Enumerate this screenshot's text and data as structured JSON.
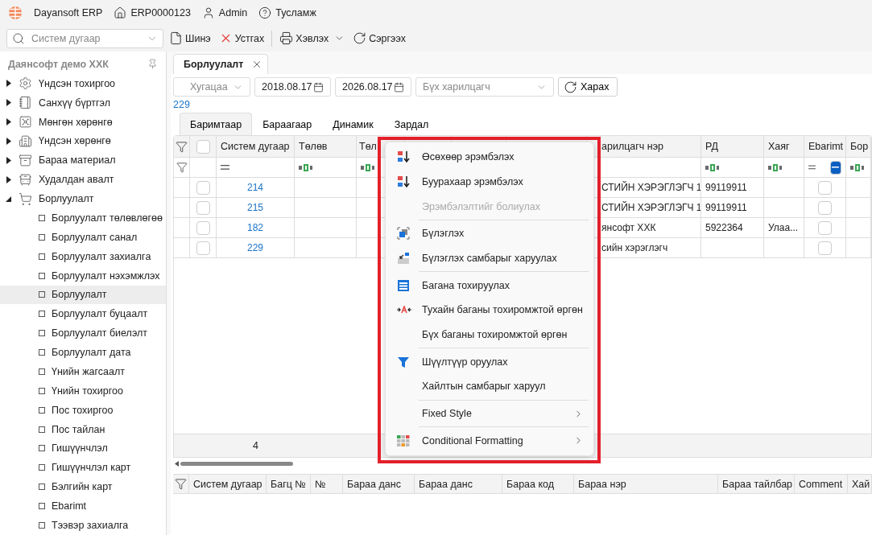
{
  "app_bar": {
    "app_name": "Dayansoft ERP",
    "database": "ERP0000123",
    "user": "Admin",
    "help": "Тусламж"
  },
  "toolbar": {
    "search_placeholder": "Систем дугаар",
    "buttons": [
      {
        "label": "Шинэ",
        "kind": "new"
      },
      {
        "label": "Устгах",
        "kind": "delete"
      },
      {
        "label": "Хэвлэх",
        "kind": "print"
      },
      {
        "label": "Сэргээх",
        "kind": "refresh"
      }
    ]
  },
  "sidebar": {
    "company": "Даянсофт демо ХХК",
    "items": [
      {
        "label": "Үндсэн тохиргоо",
        "expanded": false
      },
      {
        "label": "Санхүү бүртгэл",
        "expanded": false
      },
      {
        "label": "Мөнгөн хөрөнгө",
        "expanded": false
      },
      {
        "label": "Үндсэн хөрөнгө",
        "expanded": false
      },
      {
        "label": "Бараа материал",
        "expanded": false
      },
      {
        "label": "Худалдан авалт",
        "expanded": false
      },
      {
        "label": "Борлуулалт",
        "expanded": true,
        "children": [
          {
            "label": "Борлуулалт төлөвлөгөө",
            "selected": false
          },
          {
            "label": "Борлуулалт санал",
            "selected": false
          },
          {
            "label": "Борлуулалт захиалга",
            "selected": false
          },
          {
            "label": "Борлуулалт нэхэмжлэх",
            "selected": false
          },
          {
            "label": "Борлуулалт",
            "selected": true
          },
          {
            "label": "Борлуулалт буцаалт",
            "selected": false
          },
          {
            "label": "Борлуулалт биелэлт",
            "selected": false
          },
          {
            "label": "Борлуулалт дата",
            "selected": false
          },
          {
            "label": "Үнийн жагсаалт",
            "selected": false
          },
          {
            "label": "Үнийн тохиргоо",
            "selected": false
          },
          {
            "label": "Пос тохиргоо",
            "selected": false
          },
          {
            "label": "Пос тайлан",
            "selected": false
          },
          {
            "label": "Гишүүнчлэл",
            "selected": false
          },
          {
            "label": "Гишүүнчлэл карт",
            "selected": false
          },
          {
            "label": "Бэлгийн карт",
            "selected": false
          },
          {
            "label": "Ebarimt",
            "selected": false
          },
          {
            "label": "Тээвэр захиалга",
            "selected": false
          }
        ]
      }
    ]
  },
  "document_tab": {
    "label": "Борлуулалт"
  },
  "filters": {
    "period_placeholder": "Хугацаа",
    "date_from": "2018.08.17",
    "date_to": "2026.08.17",
    "customer_placeholder": "Бүх харилцагч",
    "view_button": "Харах"
  },
  "selected_number": "229",
  "view_tabs": [
    {
      "label": "Баримтаар",
      "selected": true
    },
    {
      "label": "Бараагаар",
      "selected": false
    },
    {
      "label": "Динамик",
      "selected": false
    },
    {
      "label": "Зардал",
      "selected": false
    }
  ],
  "grid": {
    "select_all_checked": false,
    "columns": [
      {
        "header": "Систем дугаар",
        "kind": "equals"
      },
      {
        "header": "Төлөв",
        "kind": "text"
      },
      {
        "header": "Төл",
        "kind": "text"
      },
      {
        "kind": "plain"
      },
      {
        "kind": "plain"
      },
      {
        "kind": "plain"
      },
      {
        "header": "арилцагч нэр",
        "kind": "plain"
      },
      {
        "header": "РД",
        "kind": "text"
      },
      {
        "header": "Хаяг",
        "kind": "text"
      },
      {
        "header": "Ebarimt",
        "kind": "check",
        "indeterminate": true
      },
      {
        "header": "Бор",
        "kind": "text"
      }
    ],
    "rows": [
      {
        "number": "214",
        "checked": false,
        "customer": "СТИЙН ХЭРЭГЛЭГЧ 1",
        "rd": "99119911",
        "ebarimt": false
      },
      {
        "number": "215",
        "checked": false,
        "customer": "СТИЙН ХЭРЭГЛЭГЧ 1",
        "rd": "99119911",
        "ebarimt": false
      },
      {
        "number": "182",
        "checked": false,
        "customer": "янсофт ХХК",
        "rd": "5922364",
        "address": "Улаа...",
        "ebarimt": false
      },
      {
        "number": "229",
        "checked": false,
        "customer": "сийн хэрэглэгч",
        "ebarimt": false
      }
    ],
    "footer_count": "4"
  },
  "detail_grid": {
    "columns": [
      "Систем дугаар",
      "Багц №",
      "№",
      "Бараа данс",
      "Бараа данс",
      "Бараа код",
      "Бараа нэр",
      "Бараа тайлбар",
      "Comment",
      "Хай"
    ]
  },
  "context_menu": {
    "items": [
      {
        "kind": "item",
        "label": "Өсөхөөр эрэмбэлэх",
        "disabled": false,
        "submenu": false
      },
      {
        "kind": "item",
        "label": "Буурахаар эрэмбэлэх",
        "disabled": false,
        "submenu": false
      },
      {
        "kind": "item",
        "label": "Эрэмбэлэлтийг болиулах",
        "disabled": true,
        "submenu": false
      },
      {
        "kind": "separator"
      },
      {
        "kind": "item",
        "label": "Бүлэглэх",
        "disabled": false,
        "submenu": false
      },
      {
        "kind": "item",
        "label": "Бүлэглэх самбарыг харуулах",
        "disabled": false,
        "submenu": false
      },
      {
        "kind": "separator"
      },
      {
        "kind": "item",
        "label": "Багана тохируулах",
        "disabled": false,
        "submenu": false
      },
      {
        "kind": "item",
        "label": "Тухайн баганы тохиромжтой өргөн",
        "disabled": false,
        "submenu": false
      },
      {
        "kind": "item",
        "label": "Бүх баганы тохиромжтой өргөн",
        "disabled": false,
        "submenu": false
      },
      {
        "kind": "separator"
      },
      {
        "kind": "item",
        "label": "Шүүлтүүр оруулах",
        "disabled": false,
        "submenu": false
      },
      {
        "kind": "item",
        "label": "Хайлтын самбарыг харуул",
        "disabled": false,
        "submenu": false
      },
      {
        "kind": "separator"
      },
      {
        "kind": "item",
        "label": "Fixed Style",
        "disabled": false,
        "submenu": true
      },
      {
        "kind": "separator"
      },
      {
        "kind": "item",
        "label": "Conditional Formatting",
        "disabled": false,
        "submenu": true
      }
    ]
  }
}
